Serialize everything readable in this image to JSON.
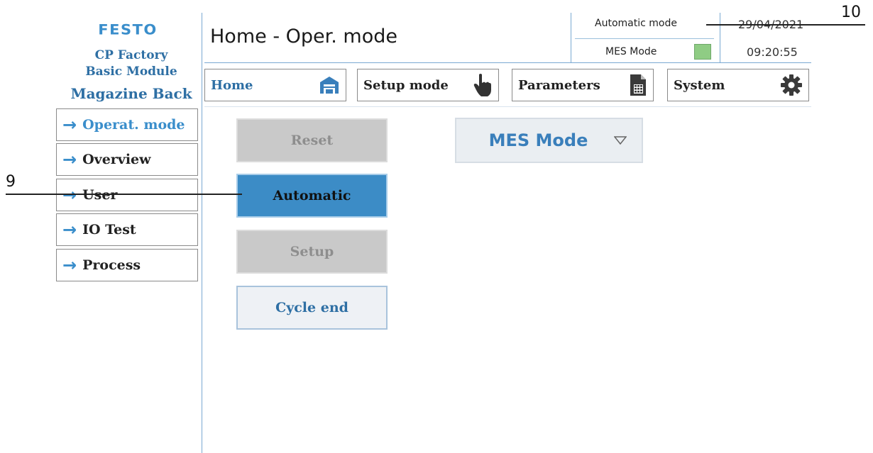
{
  "brand": {
    "logo": "FESTO",
    "line1": "CP Factory",
    "line2": "Basic Module",
    "line3": "Magazine Back"
  },
  "header": {
    "title": "Home - Oper. mode",
    "mode_label": "Automatic mode",
    "mes_label": "MES Mode",
    "date": "29/04/2021",
    "time": "09:20:55",
    "mes_status_color": "#8fcc84"
  },
  "nav": {
    "home": "Home",
    "setup": "Setup mode",
    "parameters": "Parameters",
    "system": "System"
  },
  "sidebar": {
    "items": [
      {
        "label": "Operat. mode"
      },
      {
        "label": "Overview"
      },
      {
        "label": "User"
      },
      {
        "label": "IO Test"
      },
      {
        "label": "Process"
      }
    ]
  },
  "main": {
    "reset": "Reset",
    "automatic": "Automatic",
    "setup": "Setup",
    "cycle_end": "Cycle end",
    "mode_select": "MES Mode"
  },
  "callouts": {
    "c9": "9",
    "c10": "10"
  },
  "colors": {
    "accent": "#3a8ecb",
    "active_button": "#3c8cc6",
    "disabled_button": "#c9c9c9"
  }
}
